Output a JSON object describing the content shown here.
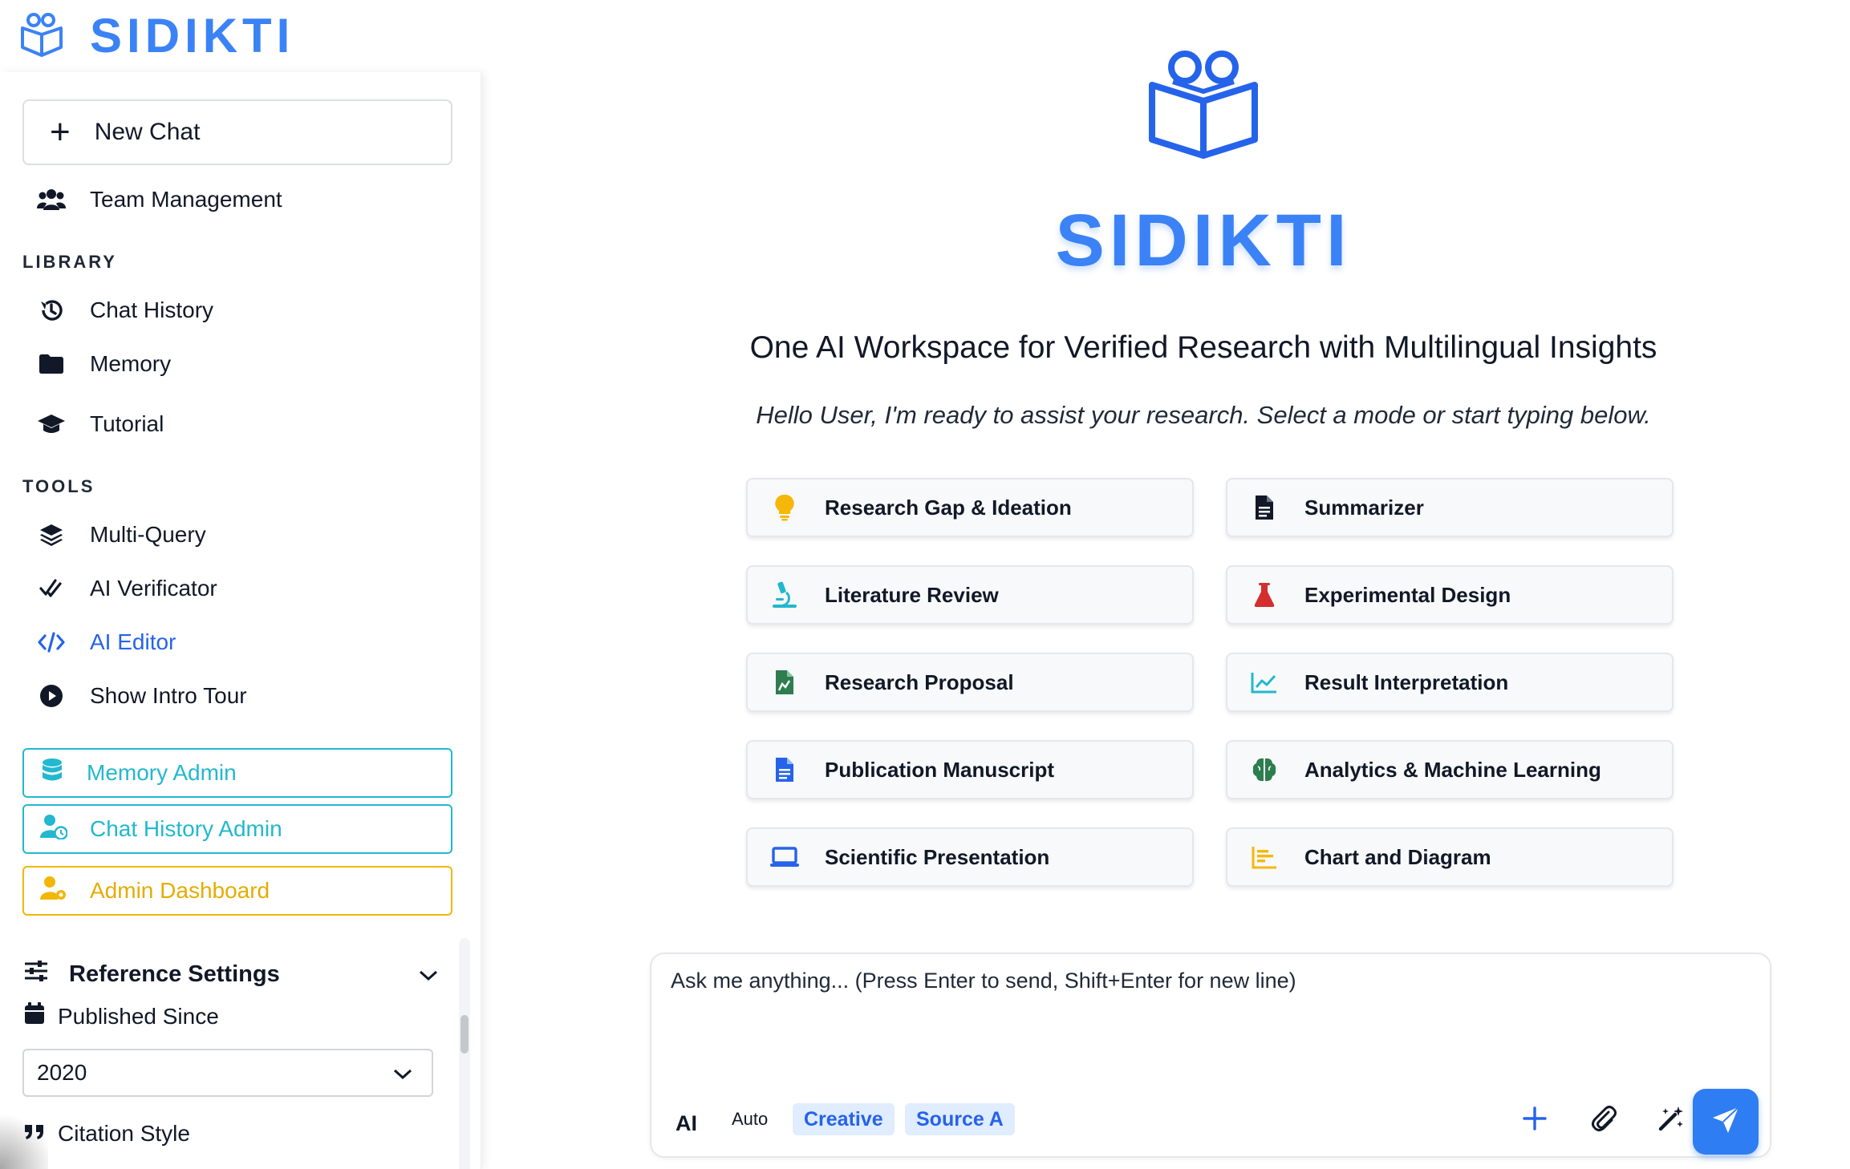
{
  "brand": {
    "name": "SIDIKTI"
  },
  "sidebar": {
    "new_chat": "New Chat",
    "team_management": "Team Management",
    "library_label": "LIBRARY",
    "library": [
      {
        "label": "Chat History",
        "icon": "history-icon"
      },
      {
        "label": "Memory",
        "icon": "folder-icon"
      },
      {
        "label": "Tutorial",
        "icon": "graduation-cap-icon"
      }
    ],
    "tools_label": "TOOLS",
    "tools": [
      {
        "label": "Multi-Query",
        "icon": "layers-icon"
      },
      {
        "label": "AI Verificator",
        "icon": "double-check-icon"
      },
      {
        "label": "AI Editor",
        "icon": "code-icon",
        "active": true
      },
      {
        "label": "Show Intro Tour",
        "icon": "play-circle-icon"
      }
    ],
    "admin": {
      "memory_admin": "Memory Admin",
      "chat_history_admin": "Chat History Admin",
      "admin_dashboard": "Admin Dashboard"
    },
    "reference": {
      "title": "Reference Settings",
      "published_since_label": "Published Since",
      "published_since_value": "2020",
      "citation_style_label": "Citation Style"
    }
  },
  "main": {
    "title": "SIDIKTI",
    "tagline": "One AI Workspace for Verified Research with Multilingual Insights",
    "greeting": "Hello User, I'm ready to assist your research. Select a mode or start typing below.",
    "modes": [
      {
        "label": "Research Gap & Ideation",
        "icon": "lightbulb-icon"
      },
      {
        "label": "Summarizer",
        "icon": "document-icon"
      },
      {
        "label": "Literature Review",
        "icon": "microscope-icon"
      },
      {
        "label": "Experimental Design",
        "icon": "flask-icon"
      },
      {
        "label": "Research Proposal",
        "icon": "file-chart-icon"
      },
      {
        "label": "Result Interpretation",
        "icon": "line-chart-icon"
      },
      {
        "label": "Publication Manuscript",
        "icon": "file-text-icon"
      },
      {
        "label": "Analytics & Machine Learning",
        "icon": "brain-icon"
      },
      {
        "label": "Scientific Presentation",
        "icon": "laptop-icon"
      },
      {
        "label": "Chart and Diagram",
        "icon": "bar-chart-icon"
      }
    ]
  },
  "chat": {
    "placeholder": "Ask me anything... (Press Enter to send, Shift+Enter for new line)",
    "ai_label": "AI",
    "chips": {
      "auto": "Auto",
      "creative": "Creative",
      "source": "Source A"
    }
  },
  "colors": {
    "brand_blue": "#3b82f6",
    "active_link": "#2563eb",
    "cyan_admin": "#22b8cf",
    "yellow_admin": "#f2b705",
    "send_button": "#2f7df3"
  }
}
